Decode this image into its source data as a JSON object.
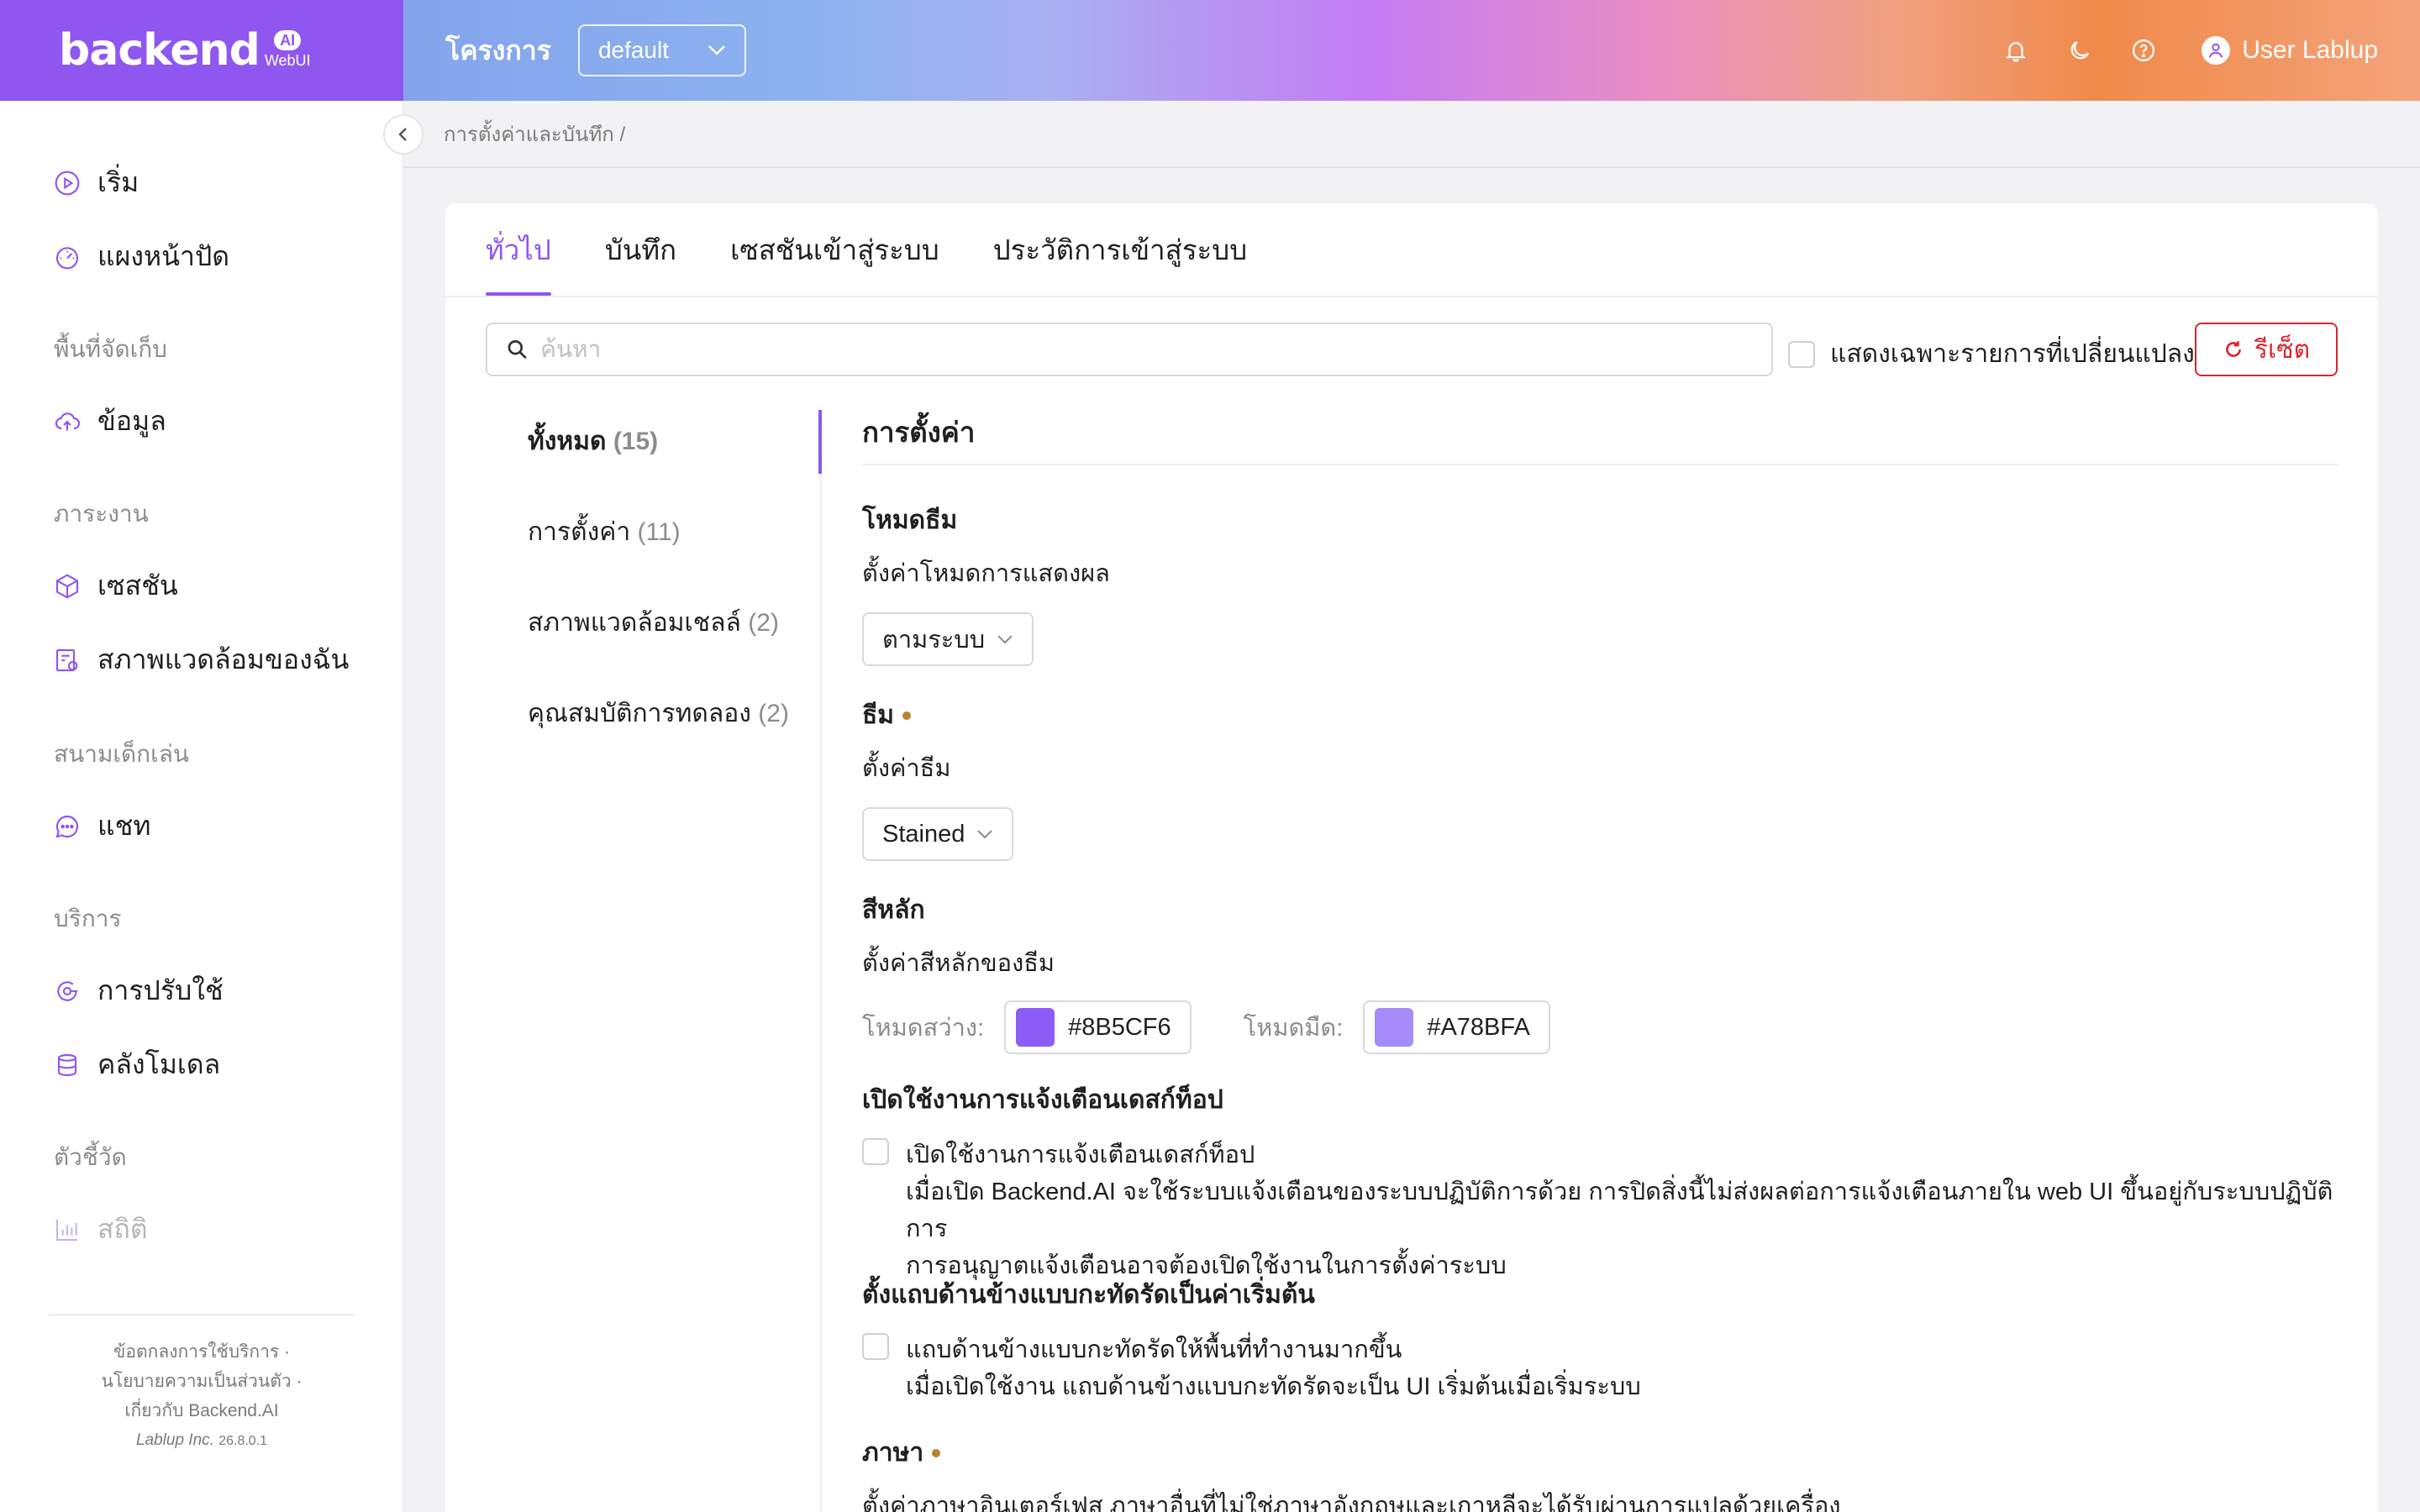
{
  "header": {
    "logo_text": "backend",
    "logo_ai": "AI",
    "logo_sub": "WebUI",
    "project_label": "โครงการ",
    "project_value": "default",
    "user_name": "User Lablup"
  },
  "sidebar": {
    "items": {
      "start": "เริ่ม",
      "dashboard": "แผงหน้าปัด",
      "storage_group": "พื้นที่จัดเก็บ",
      "data": "ข้อมูล",
      "workload_group": "ภาระงาน",
      "session": "เซสชัน",
      "my_env": "สภาพแวดล้อมของฉัน",
      "playground_group": "สนามเด็กเล่น",
      "chat": "แชท",
      "service_group": "บริการ",
      "serving": "การปรับใช้",
      "model_store": "คลังโมเดล",
      "metrics_group": "ตัวชี้วัด",
      "statistics": "สถิติ"
    },
    "footer": {
      "terms": "ข้อตกลงการใช้บริการ ·",
      "privacy": "นโยบายความเป็นส่วนตัว ·",
      "about": "เกี่ยวกับ Backend.AI",
      "company": "Lablup Inc.",
      "version": "26.8.0.1"
    }
  },
  "breadcrumb": "การตั้งค่าและบันทึก  /",
  "tabs": [
    "ทั่วไป",
    "บันทึก",
    "เซสชันเข้าสู่ระบบ",
    "ประวัติการเข้าสู่ระบบ"
  ],
  "toolbar": {
    "search_placeholder": "ค้นหา",
    "changed_only_label": "แสดงเฉพาะรายการที่เปลี่ยนแปลง",
    "reset_label": "รีเซ็ต"
  },
  "categories": [
    {
      "label": "ทั้งหมด",
      "count": "(15)"
    },
    {
      "label": "การตั้งค่า",
      "count": "(11)"
    },
    {
      "label": "สภาพแวดล้อมเชลล์",
      "count": "(2)"
    },
    {
      "label": "คุณสมบัติการทดลอง",
      "count": "(2)"
    }
  ],
  "content": {
    "section_title": "การตั้งค่า",
    "theme_mode": {
      "title": "โหมดธีม",
      "desc": "ตั้งค่าโหมดการแสดงผล",
      "value": "ตามระบบ"
    },
    "theme": {
      "title": "ธีม",
      "desc": "ตั้งค่าธีม",
      "value": "Stained"
    },
    "primary_color": {
      "title": "สีหลัก",
      "desc": "ตั้งค่าสีหลักของธีม",
      "light_label": "โหมดสว่าง:",
      "light_value": "#8B5CF6",
      "dark_label": "โหมดมืด:",
      "dark_value": "#A78BFA"
    },
    "desktop_notif": {
      "title": "เปิดใช้งานการแจ้งเตือนเดสก์ท็อป",
      "check_label": "เปิดใช้งานการแจ้งเตือนเดสก์ท็อป",
      "desc1": "เมื่อเปิด Backend.AI จะใช้ระบบแจ้งเตือนของระบบปฏิบัติการด้วย การปิดสิ่งนี้ไม่ส่งผลต่อการแจ้งเตือนภายใน web UI ขึ้นอยู่กับระบบปฏิบัติการ",
      "desc2": "การอนุญาตแจ้งเตือนอาจต้องเปิดใช้งานในการตั้งค่าระบบ"
    },
    "compact_sidebar": {
      "title": "ตั้งแถบด้านข้างแบบกะทัดรัดเป็นค่าเริ่มต้น",
      "check_label": "แถบด้านข้างแบบกะทัดรัดให้พื้นที่ทำงานมากขึ้น",
      "desc": "เมื่อเปิดใช้งาน แถบด้านข้างแบบกะทัดรัดจะเป็น UI เริ่มต้นเมื่อเริ่มระบบ"
    },
    "language": {
      "title": "ภาษา",
      "desc": "ตั้งค่าภาษาอินเตอร์เฟส ภาษาอื่นที่ไม่ใช่ภาษาอังกฤษและเกาหลีจะได้รับผ่านการแปลด้วยเครื่อง"
    }
  },
  "colors": {
    "accent": "#8f56f0",
    "danger": "#d9262d",
    "light_swatch": "#8B5CF6",
    "dark_swatch": "#A78BFA"
  }
}
